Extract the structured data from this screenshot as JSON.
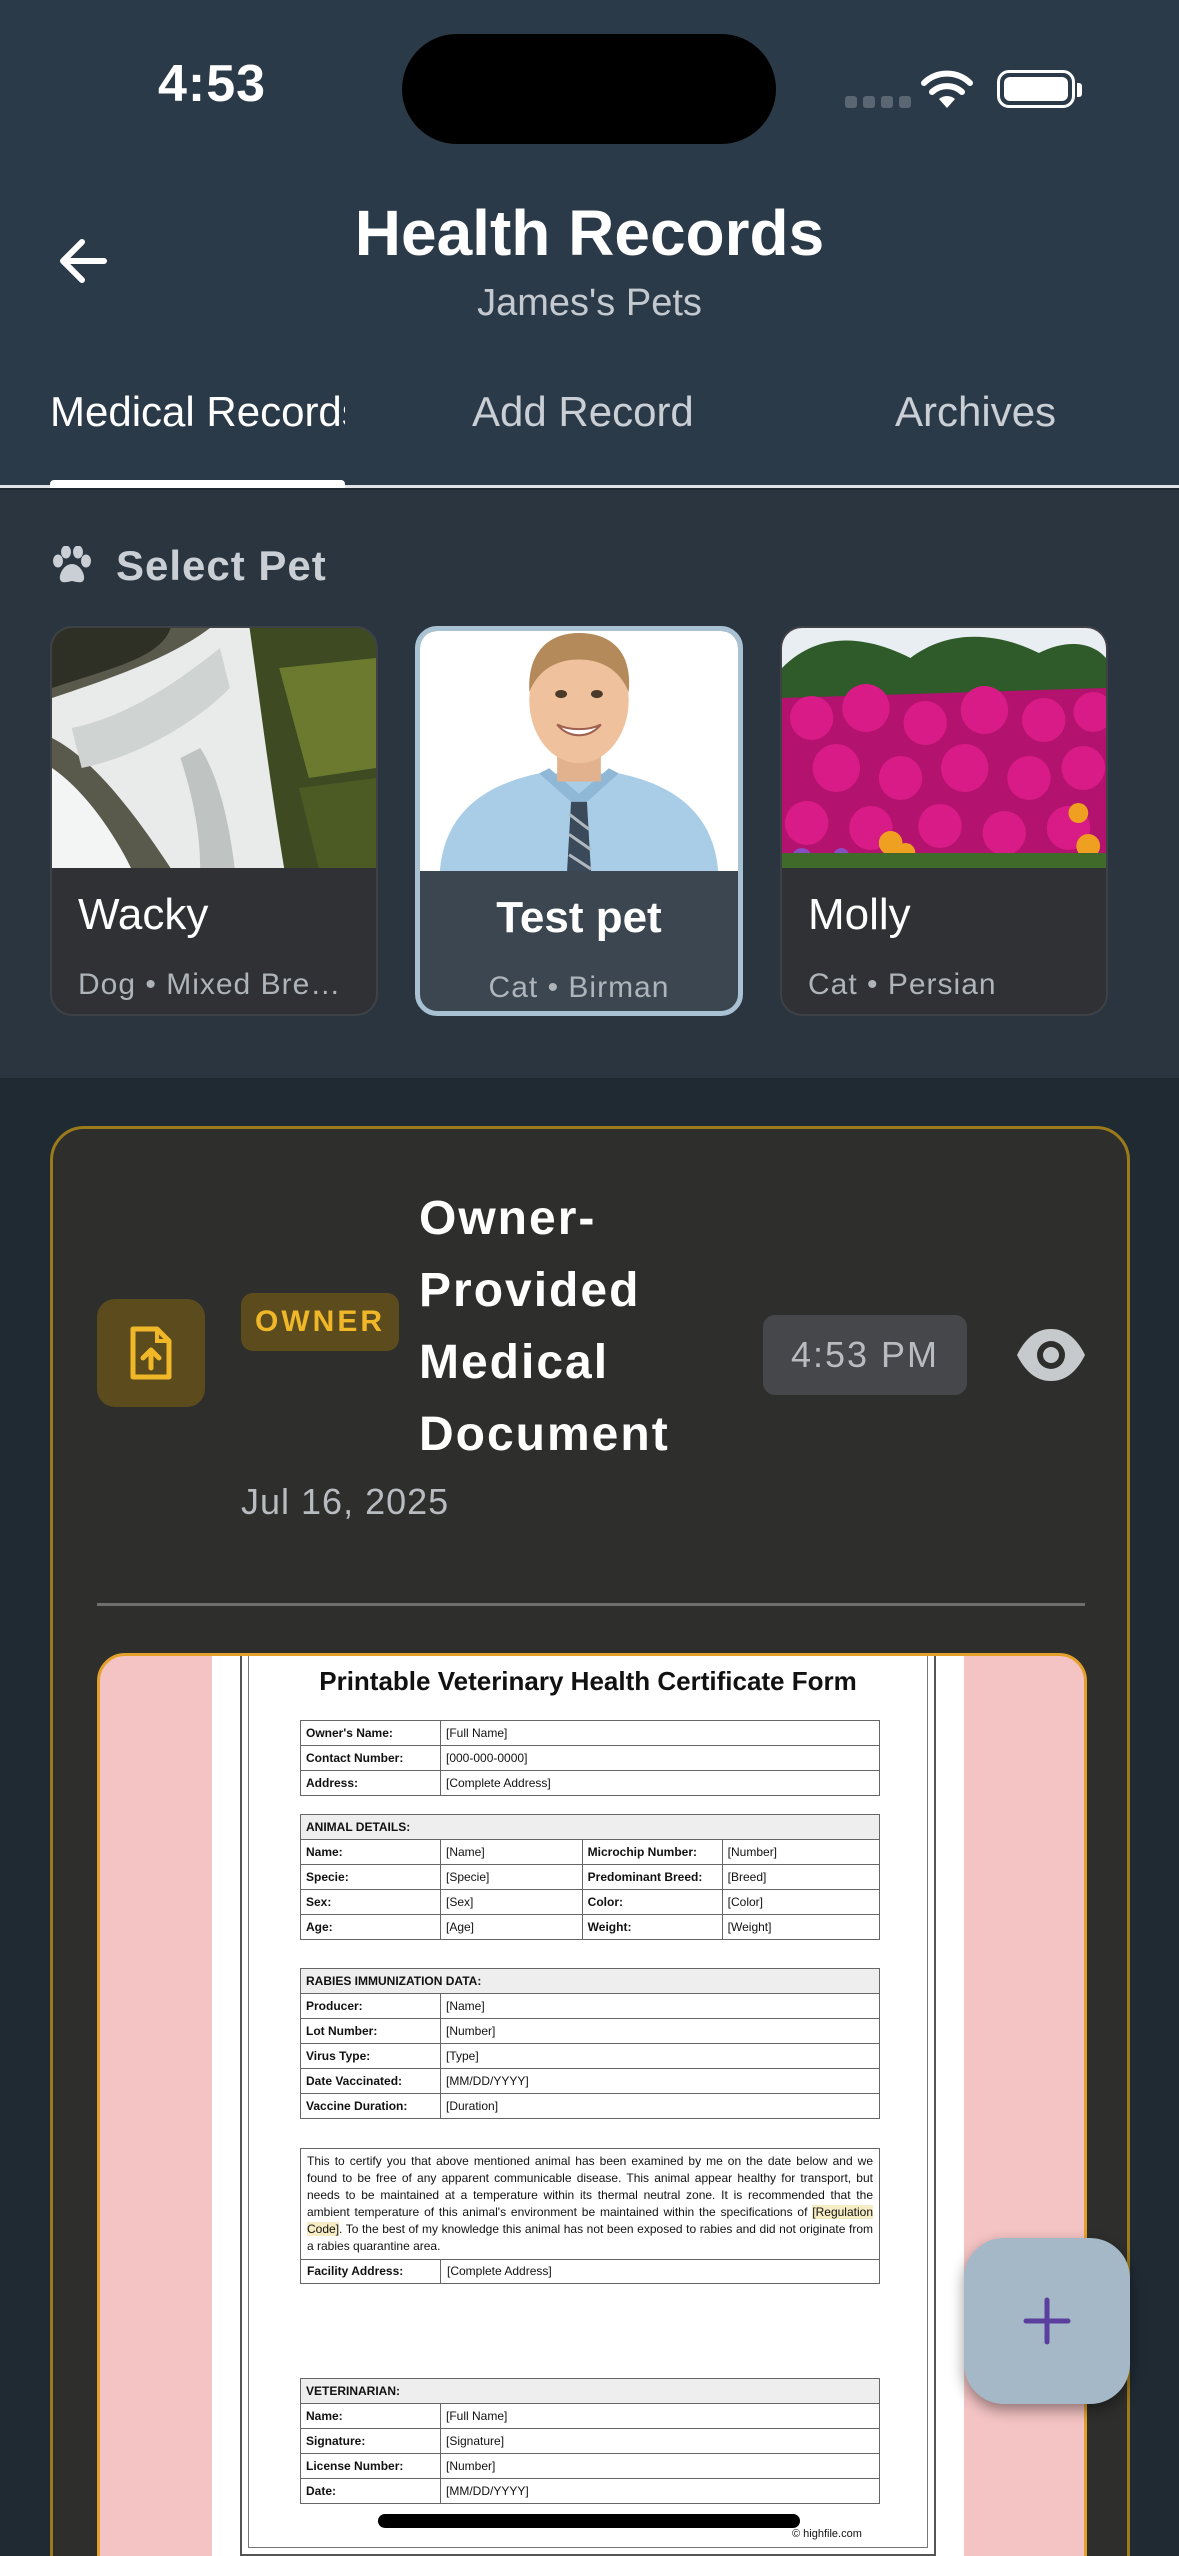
{
  "status_bar": {
    "time": "4:53"
  },
  "header": {
    "title": "Health Records",
    "subtitle": "James's Pets"
  },
  "tabs": [
    {
      "label": "Medical Records",
      "active": true
    },
    {
      "label": "Add Record",
      "active": false
    },
    {
      "label": "Archives",
      "active": false
    }
  ],
  "pet_selector": {
    "label": "Select Pet",
    "icon": "paw-icon",
    "pets": [
      {
        "name": "Wacky",
        "details": "Dog • Mixed Bre…",
        "image": "waterfall-photo",
        "selected": false
      },
      {
        "name": "Test pet",
        "details": "Cat • Birman",
        "image": "man-portrait-photo",
        "selected": true
      },
      {
        "name": "Molly",
        "details": "Cat • Persian",
        "image": "flowers-photo",
        "selected": false
      }
    ]
  },
  "record": {
    "badge": "OWNER",
    "title": "Owner-Provided Medical Document",
    "date": "Jul 16, 2025",
    "time": "4:53 PM",
    "icons": {
      "doc": "file-upload-icon",
      "view": "eye-icon"
    },
    "preview": {
      "form_title": "Printable Veterinary Health Certificate Form",
      "owner_rows": [
        [
          "Owner's Name:",
          "[Full Name]"
        ],
        [
          "Contact Number:",
          "[000-000-0000]"
        ],
        [
          "Address:",
          "[Complete Address]"
        ]
      ],
      "animal_header": "ANIMAL DETAILS:",
      "animal_rows": [
        [
          "Name:",
          "[Name]",
          "Microchip Number:",
          "[Number]"
        ],
        [
          "Specie:",
          "[Specie]",
          "Predominant Breed:",
          "[Breed]"
        ],
        [
          "Sex:",
          "[Sex]",
          "Color:",
          "[Color]"
        ],
        [
          "Age:",
          "[Age]",
          "Weight:",
          "[Weight]"
        ]
      ],
      "rabies_header": "RABIES IMMUNIZATION DATA:",
      "rabies_rows": [
        [
          "Producer:",
          "[Name]"
        ],
        [
          "Lot Number:",
          "[Number]"
        ],
        [
          "Virus Type:",
          "[Type]"
        ],
        [
          "Date Vaccinated:",
          "[MM/DD/YYYY]"
        ],
        [
          "Vaccine Duration:",
          "[Duration]"
        ]
      ],
      "certify_text_1": "This to certify you that above mentioned animal has been examined by me on the date below and we found to be free of any apparent communicable disease. This animal appear healthy for transport, but needs to be maintained at a temperature within its thermal neutral zone. It is recommended that the ambient temperature of this animal's environment be maintained within the specifications of ",
      "certify_highlight": "[Regulation Code]",
      "certify_text_2": ". To the best of my knowledge this animal has not been exposed to rabies and did not originate from a rabies quarantine area.",
      "facility_label": "Facility Address:",
      "facility_value": "[Complete Address]",
      "vet_header": "VETERINARIAN:",
      "vet_rows": [
        [
          "Name:",
          "[Full Name]"
        ],
        [
          "Signature:",
          "[Signature]"
        ],
        [
          "License Number:",
          "[Number]"
        ],
        [
          "Date:",
          "[MM/DD/YYYY]"
        ]
      ],
      "copyright": "© highfile.com"
    }
  },
  "fab": {
    "icon": "plus-icon"
  },
  "colors": {
    "header_bg": "#2b3a48",
    "card_border": "#9b7a1c",
    "owner_badge_text": "#f0b829",
    "fab_bg": "#a5b8c8",
    "fab_icon": "#5b3f9e"
  }
}
